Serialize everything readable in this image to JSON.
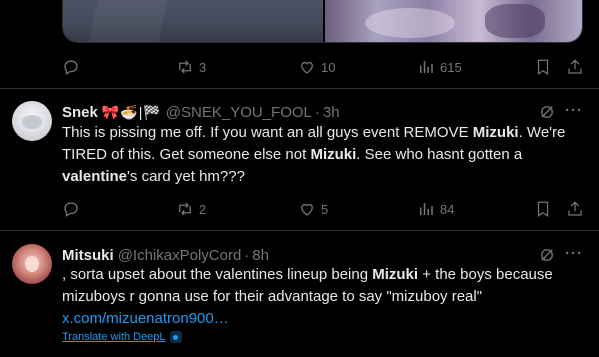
{
  "prev_tweet": {
    "actions": {
      "replies": "",
      "retweets": "3",
      "likes": "10",
      "views": "615"
    }
  },
  "tweets": [
    {
      "name": "Snek",
      "emojis": "🎀🍜|🏁",
      "handle": "@SNEK_YOU_FOOL",
      "separator": "·",
      "time": "3h",
      "body": {
        "p1": "This is pissing me off. If you want an all guys event REMOVE ",
        "b1": "Mizuki",
        "p2": ". We're TIRED of this. Get someone else not ",
        "b2": "Mizuki",
        "p3": ". See who hasnt gotten a ",
        "b3": "valentine",
        "p4": "'s card yet hm???"
      },
      "actions": {
        "replies": "",
        "retweets": "2",
        "likes": "5",
        "views": "84"
      }
    },
    {
      "name": "Mitsuki",
      "handle": "@IchikaxPolyCord",
      "separator": "·",
      "time": "8h",
      "body": {
        "p1": ", sorta upset about the valentines lineup being ",
        "b1": "Mizuki",
        "p2": " + the boys because mizuboys r gonna use for their advantage to say \"mizuboy real\"",
        "link": "x.com/mizuenatron900…"
      },
      "translate": "Translate with DeepL"
    }
  ]
}
